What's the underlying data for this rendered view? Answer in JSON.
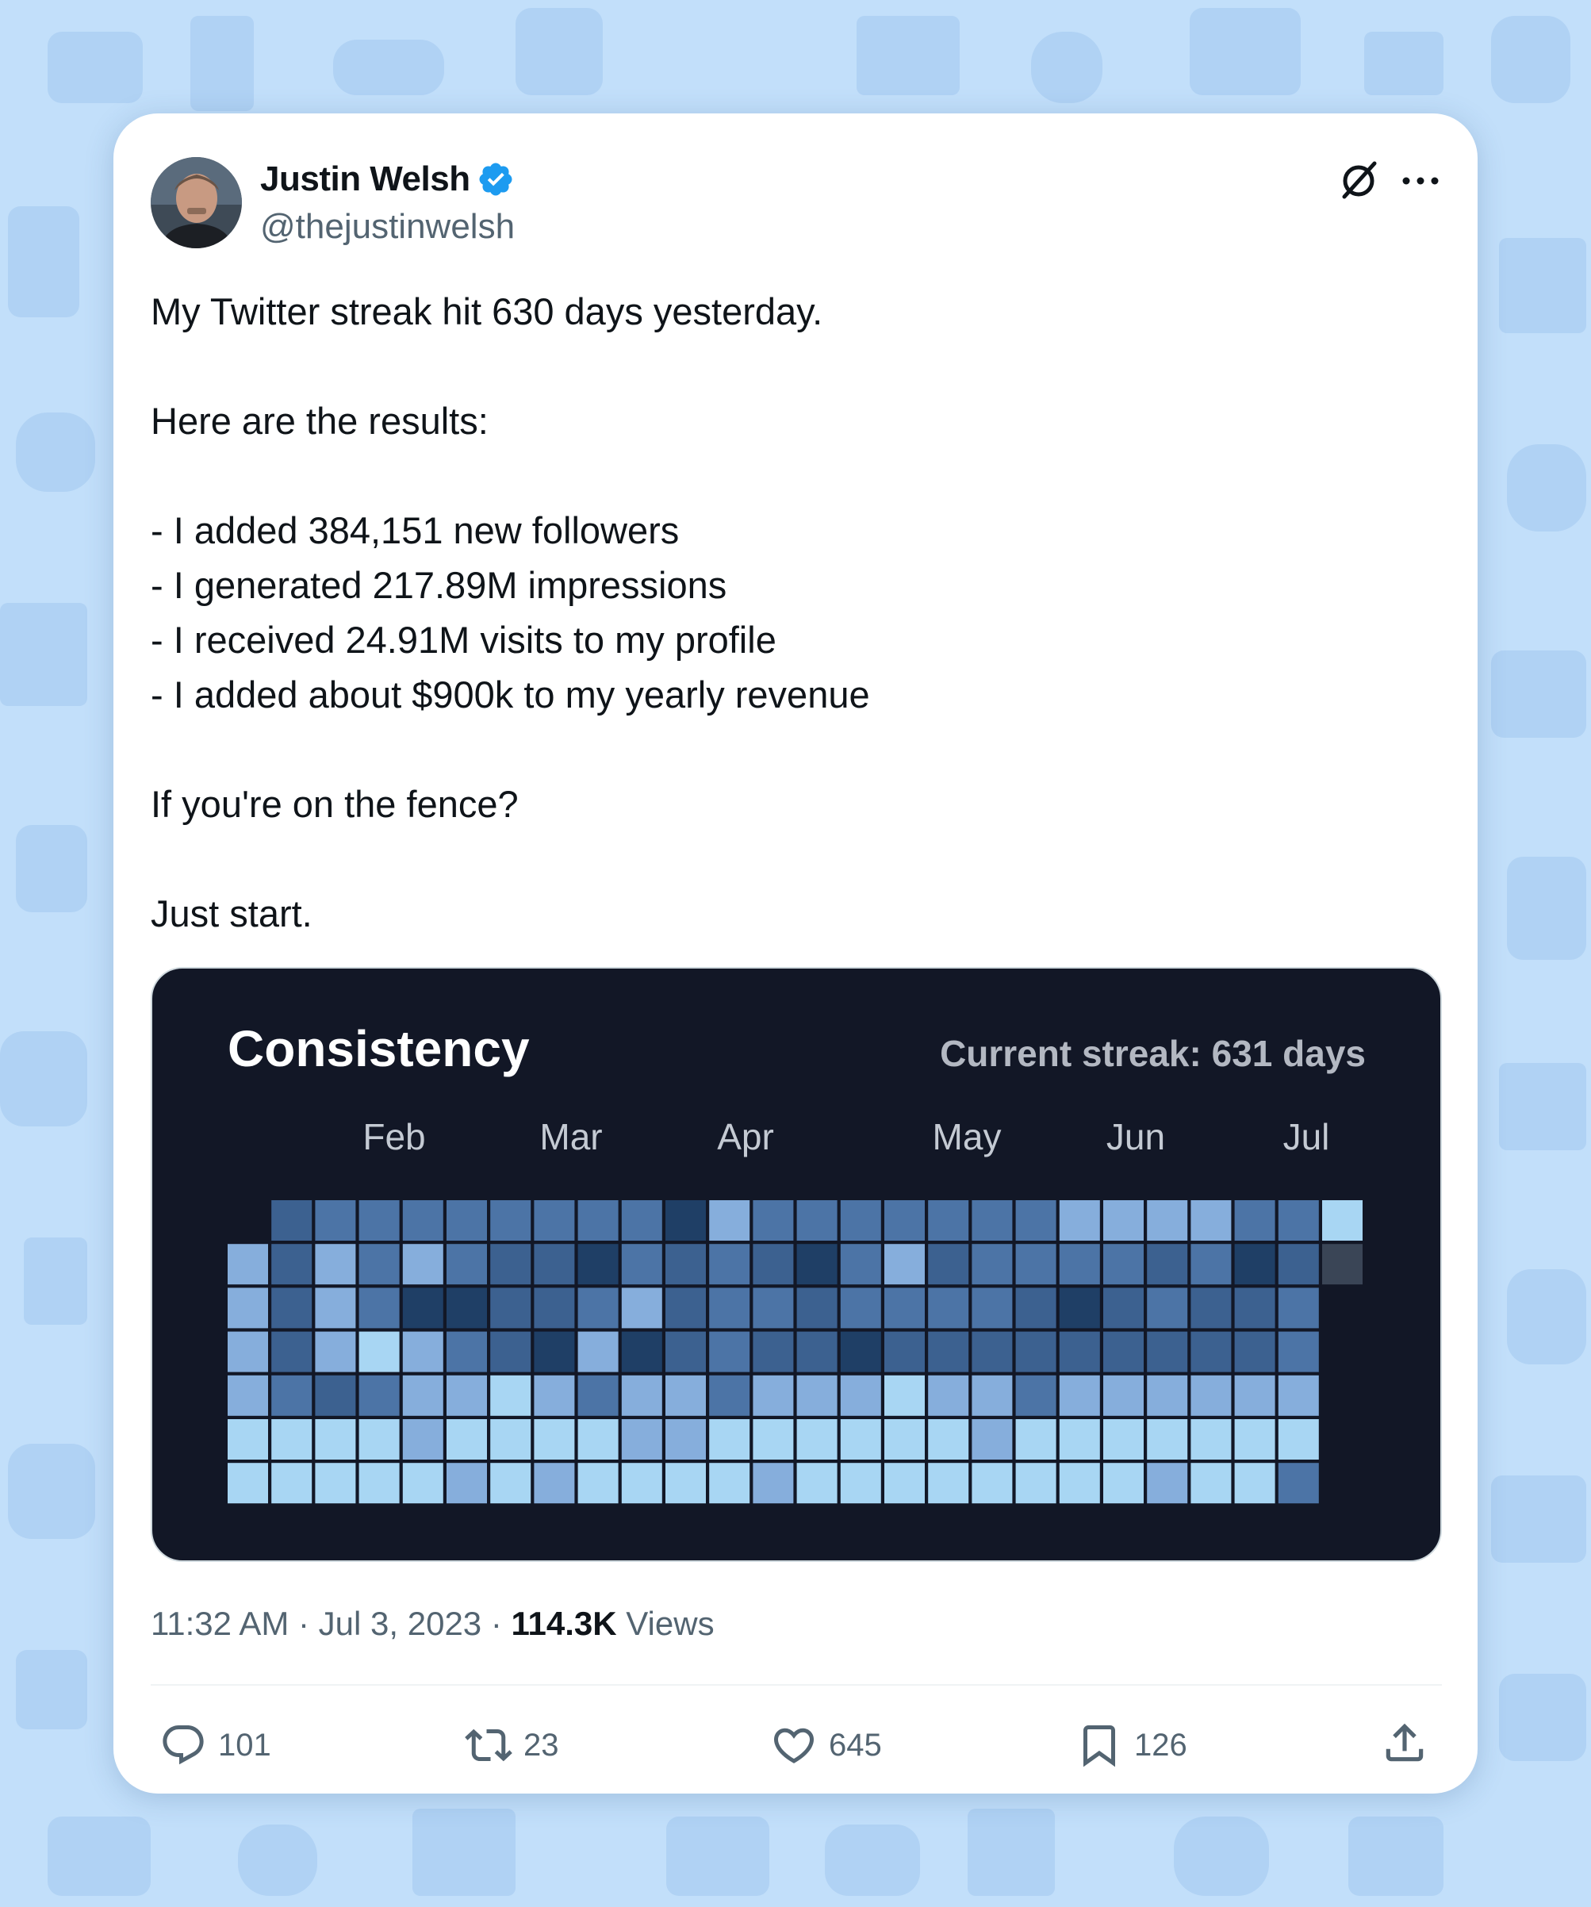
{
  "author": {
    "name": "Justin Welsh",
    "handle": "@thejustinwelsh",
    "verified": true,
    "avatar_icon": "profile-photo"
  },
  "tweet": {
    "lines": [
      "My Twitter streak hit 630 days yesterday.",
      "",
      "Here are the results:",
      "",
      "- I added 384,151 new followers",
      "- I generated 217.89M impressions",
      "- I received 24.91M visits to my profile",
      "- I added about $900k to my yearly revenue",
      "",
      "If you're on the fence?",
      "",
      "Just start."
    ]
  },
  "media": {
    "title": "Consistency",
    "streak_label": "Current streak: 631 days",
    "months": [
      "Feb",
      "Mar",
      "Apr",
      "May",
      "Jun",
      "Jul"
    ],
    "palette": [
      "#1f3f66",
      "#3c6190",
      "#4c74a6",
      "#86aedc",
      "#a8d6f3",
      "#3a4556"
    ],
    "grid_levels": [
      [
        -1,
        1,
        2,
        2,
        2,
        2,
        2,
        2,
        2,
        2,
        0,
        3,
        2,
        2,
        2,
        2,
        2,
        2,
        2,
        3,
        3,
        3,
        3,
        2,
        2,
        4
      ],
      [
        3,
        1,
        3,
        2,
        3,
        2,
        1,
        1,
        0,
        2,
        1,
        2,
        1,
        0,
        2,
        3,
        1,
        2,
        2,
        2,
        2,
        1,
        2,
        0,
        1,
        5
      ],
      [
        3,
        1,
        3,
        2,
        0,
        0,
        1,
        1,
        2,
        3,
        1,
        2,
        2,
        1,
        2,
        2,
        2,
        2,
        1,
        0,
        1,
        2,
        1,
        1,
        2,
        -1
      ],
      [
        3,
        1,
        3,
        4,
        3,
        2,
        1,
        0,
        3,
        0,
        1,
        2,
        1,
        1,
        0,
        1,
        1,
        1,
        1,
        1,
        1,
        1,
        1,
        1,
        2,
        -1
      ],
      [
        3,
        2,
        1,
        2,
        3,
        3,
        4,
        3,
        2,
        3,
        3,
        2,
        3,
        3,
        3,
        4,
        3,
        3,
        2,
        3,
        3,
        3,
        3,
        3,
        3,
        -1
      ],
      [
        4,
        4,
        4,
        4,
        3,
        4,
        4,
        4,
        4,
        3,
        3,
        4,
        4,
        4,
        4,
        4,
        4,
        3,
        4,
        4,
        4,
        4,
        4,
        4,
        4,
        -1
      ],
      [
        4,
        4,
        4,
        4,
        4,
        3,
        4,
        3,
        4,
        4,
        4,
        4,
        3,
        4,
        4,
        4,
        4,
        4,
        4,
        4,
        4,
        3,
        4,
        4,
        2,
        -1
      ]
    ]
  },
  "meta": {
    "time": "11:32 AM",
    "sep": " · ",
    "date": "Jul 3, 2023",
    "views_count": "114.3K",
    "views_label": "Views"
  },
  "actions": {
    "replies": "101",
    "reposts": "23",
    "likes": "645",
    "bookmarks": "126"
  },
  "colors": {
    "verified": "#1d9bf0",
    "background": "#c2dffa",
    "card": "#ffffff",
    "media_bg": "#121726",
    "text_primary": "#0f1419",
    "text_secondary": "#536471"
  }
}
